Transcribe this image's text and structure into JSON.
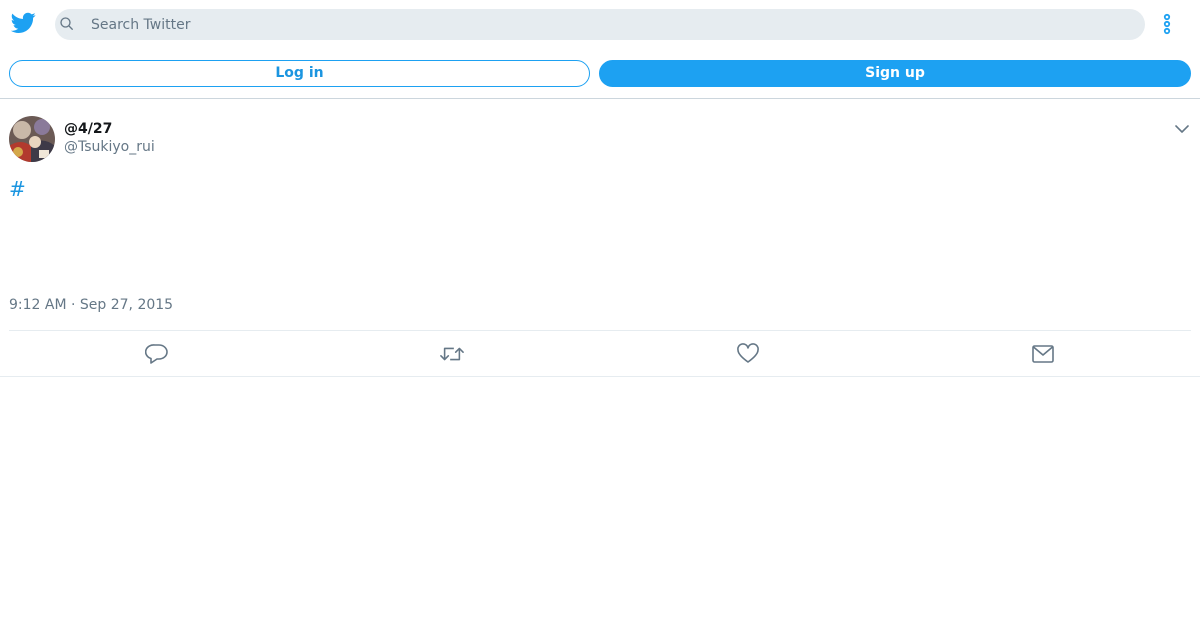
{
  "header": {
    "logo_icon": "twitter-bird-icon",
    "search_placeholder": "Search Twitter",
    "more_icon": "vertical-ellipsis-icon",
    "brand_color": "#1da1f2"
  },
  "auth": {
    "login_label": "Log in",
    "signup_label": "Sign up"
  },
  "tweet": {
    "display_name": "@4/27",
    "handle": "@Tsukiyo_rui",
    "text": "#",
    "timestamp": "9:12 AM · Sep 27, 2015",
    "menu_icon": "chevron-down-icon"
  },
  "actions": [
    {
      "name": "reply",
      "icon": "reply-icon"
    },
    {
      "name": "retweet",
      "icon": "retweet-icon"
    },
    {
      "name": "like",
      "icon": "heart-icon"
    },
    {
      "name": "direct-message",
      "icon": "envelope-icon"
    }
  ]
}
